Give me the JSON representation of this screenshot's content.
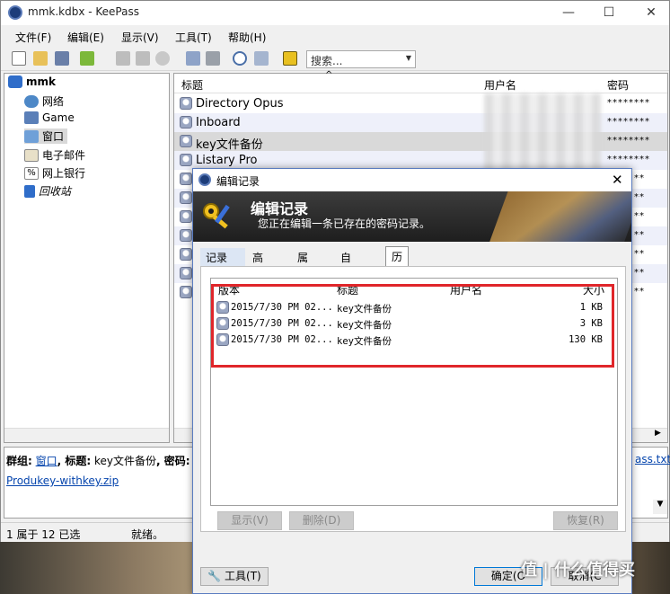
{
  "main_window": {
    "title": "mmk.kdbx - KeePass",
    "menu": [
      "文件(F)",
      "编辑(E)",
      "显示(V)",
      "工具(T)",
      "帮助(H)"
    ],
    "search_placeholder": "搜索...",
    "tree": {
      "root": "mmk",
      "groups": [
        "网络",
        "Game",
        "窗口",
        "电子邮件",
        "网上银行",
        "回收站"
      ]
    },
    "list": {
      "columns": [
        "标题",
        "用户名",
        "密码"
      ],
      "entries": [
        {
          "title": "Directory Opus",
          "password": "********"
        },
        {
          "title": "Inboard",
          "password": "********"
        },
        {
          "title": "key文件备份",
          "password": "********"
        },
        {
          "title": "Listary Pro",
          "password": "********"
        }
      ],
      "partial_passwords": [
        "**",
        "**",
        "**",
        "**",
        "**",
        "**",
        "**"
      ]
    },
    "notes": {
      "group_label": "群组:",
      "group_value": "窗口",
      "title_label": ", 标题:",
      "title_value": "key文件备份",
      "password_label": ", 密码:",
      "password_value": "**",
      "attachment_right": "ass.txt,",
      "attachment_link": "Produkey-withkey.zip"
    },
    "status": {
      "selection": "1 属于 12 已选",
      "state": "就绪。"
    }
  },
  "dialog": {
    "title": "编辑记录",
    "banner_title": "编辑记录",
    "banner_subtitle": "您正在编辑一条已存在的密码记录。",
    "tabs": [
      "记录",
      "高级",
      "属性",
      "自动输入",
      "历史"
    ],
    "active_tab": "历史",
    "history": {
      "columns": [
        "版本",
        "标题",
        "用户名",
        "大小"
      ],
      "rows": [
        {
          "version": "2015/7/30 PM 02...",
          "title": "key文件备份",
          "user": "",
          "size": "1 KB"
        },
        {
          "version": "2015/7/30 PM 02...",
          "title": "key文件备份",
          "user": "",
          "size": "3 KB"
        },
        {
          "version": "2015/7/30 PM 02...",
          "title": "key文件备份",
          "user": "",
          "size": "130 KB"
        }
      ]
    },
    "buttons": {
      "view": "显示(V)",
      "delete": "删除(D)",
      "restore": "恢复(R)",
      "tools": "工具(T)",
      "ok": "确定(O",
      "cancel": "取消(C"
    }
  },
  "watermark": "值 | 什么值得买",
  "colors": {
    "highlight": "#e0262a",
    "link": "#0645ad"
  }
}
